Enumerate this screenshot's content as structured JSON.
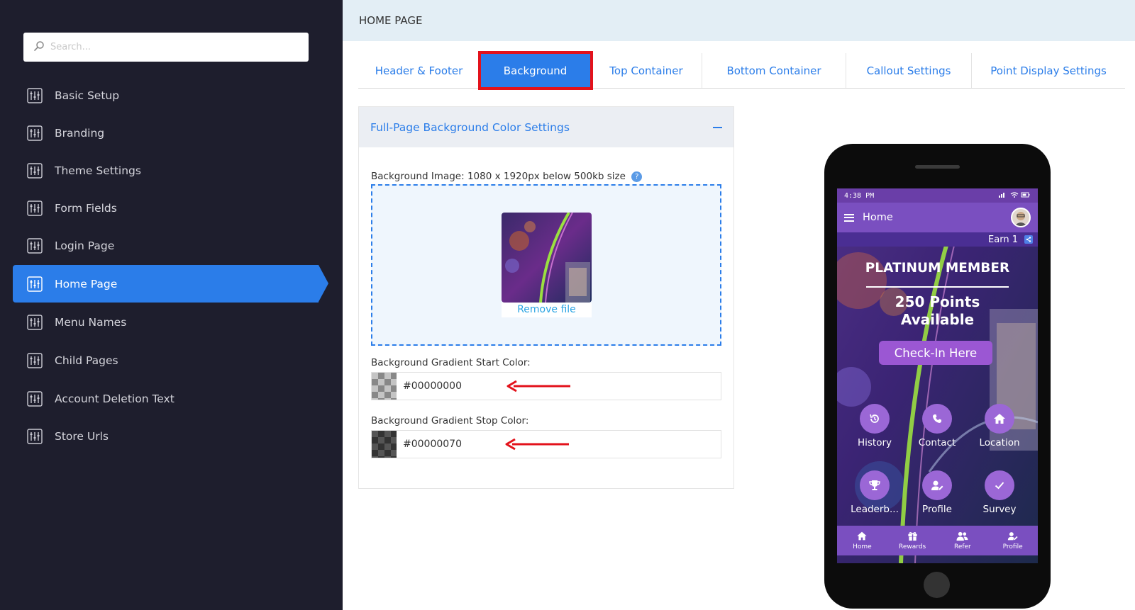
{
  "sidebar": {
    "search_placeholder": "Search...",
    "items": [
      {
        "label": "Basic Setup",
        "icon": "sliders-icon"
      },
      {
        "label": "Branding",
        "icon": "sliders-icon"
      },
      {
        "label": "Theme Settings",
        "icon": "sliders-icon"
      },
      {
        "label": "Form Fields",
        "icon": "sliders-icon"
      },
      {
        "label": "Login Page",
        "icon": "sliders-icon"
      },
      {
        "label": "Home Page",
        "icon": "sliders-icon",
        "active": true
      },
      {
        "label": "Menu Names",
        "icon": "sliders-icon"
      },
      {
        "label": "Child Pages",
        "icon": "sliders-icon"
      },
      {
        "label": "Account Deletion Text",
        "icon": "sliders-icon"
      },
      {
        "label": "Store Urls",
        "icon": "sliders-icon"
      }
    ]
  },
  "header": {
    "title": "HOME PAGE"
  },
  "tabs": [
    {
      "label": "Header & Footer"
    },
    {
      "label": "Background",
      "active": true
    },
    {
      "label": "Top Container"
    },
    {
      "label": "Bottom Container"
    },
    {
      "label": "Callout Settings"
    },
    {
      "label": "Point Display Settings"
    }
  ],
  "panel": {
    "title": "Full-Page Background Color Settings",
    "bg_image_label": "Background Image: 1080 x 1920px below 500kb size",
    "help_icon": "?",
    "remove_file": "Remove file",
    "start_label": "Background Gradient Start Color:",
    "start_value": "#00000000",
    "stop_label": "Background Gradient Stop Color:",
    "stop_value": "#00000070"
  },
  "phone": {
    "time": "4:38 PM",
    "app_title": "Home",
    "earn": "Earn 1",
    "tier": "PLATINUM MEMBER",
    "points_line1": "250 Points",
    "points_line2": "Available",
    "checkin": "Check-In Here",
    "tiles": [
      {
        "label": "History",
        "icon": "history-icon"
      },
      {
        "label": "Contact",
        "icon": "phone-icon"
      },
      {
        "label": "Location",
        "icon": "home-icon"
      },
      {
        "label": "Leaderb...",
        "icon": "trophy-icon"
      },
      {
        "label": "Profile",
        "icon": "user-edit-icon"
      },
      {
        "label": "Survey",
        "icon": "check-icon"
      }
    ],
    "bottom_nav": [
      {
        "label": "Home",
        "icon": "home-icon"
      },
      {
        "label": "Rewards",
        "icon": "gift-icon"
      },
      {
        "label": "Refer",
        "icon": "users-icon"
      },
      {
        "label": "Profile",
        "icon": "user-edit-icon"
      }
    ]
  },
  "colors": {
    "sidebar_bg": "#1e1e2d",
    "accent": "#2b7de9",
    "highlight_red": "#e3121b",
    "phone_purple": "#7a4fc0"
  }
}
